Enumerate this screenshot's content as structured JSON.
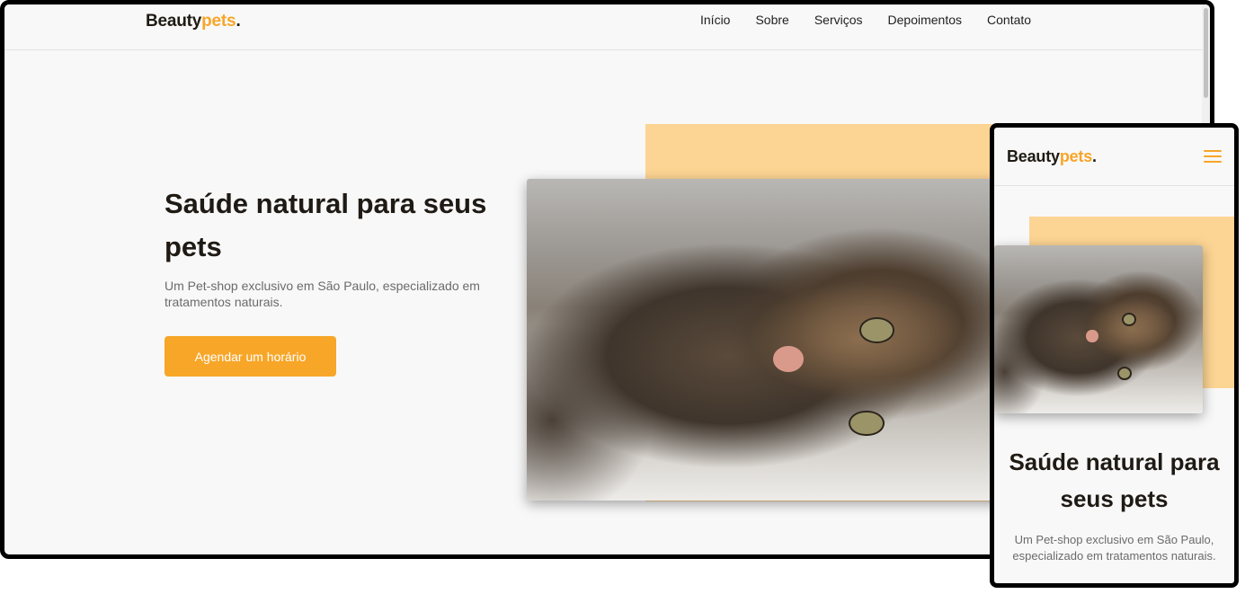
{
  "brand": {
    "name": "Beauty",
    "accent": "pets",
    "dot": "."
  },
  "nav": {
    "items": [
      "Início",
      "Sobre",
      "Serviços",
      "Depoimentos",
      "Contato"
    ]
  },
  "hero": {
    "title": "Saúde natural para seus pets",
    "subtitle": "Um Pet-shop exclusivo em São Paulo, especializado em tratamentos naturais.",
    "cta": "Agendar um horário"
  },
  "colors": {
    "accent": "#f7a628",
    "decor": "#fcd493",
    "text": "#1f1a14",
    "muted": "#6b6b6b",
    "background": "#f8f8f8"
  },
  "icons": {
    "mobile_menu": "hamburger-menu-icon",
    "hero_image": "cat-photo"
  }
}
